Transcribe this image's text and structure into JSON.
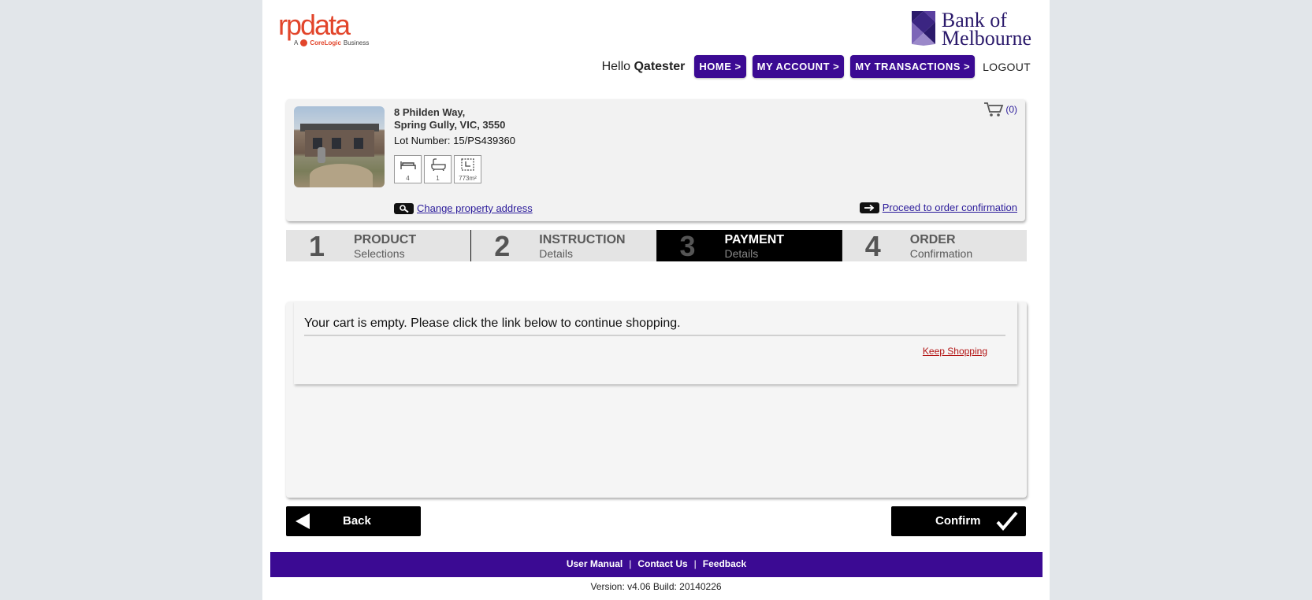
{
  "header": {
    "logo_left": {
      "word": "rpdata",
      "sub_prefix": "A",
      "sub_brand": "CoreLogic",
      "sub_suffix": "Business"
    },
    "logo_right": {
      "line1": "Bank of",
      "line2": "Melbourne"
    },
    "greeting": "Hello",
    "username": "Qatester",
    "nav": [
      {
        "label": "HOME >"
      },
      {
        "label": "MY ACCOUNT >"
      },
      {
        "label": "MY TRANSACTIONS >"
      }
    ],
    "logout_label": "LOGOUT"
  },
  "property": {
    "address_line1": "8 Philden Way,",
    "address_line2": "Spring Gully, VIC, 3550",
    "lot": "Lot Number: 15/PS439360",
    "features": {
      "beds": "4",
      "baths": "1",
      "area": "773m²"
    },
    "cart_count": "(0)",
    "change_address_label": "Change property address",
    "proceed_label": "Proceed to order confirmation"
  },
  "steps": [
    {
      "num": "1",
      "title": "PRODUCT",
      "subtitle": "Selections",
      "active": false
    },
    {
      "num": "2",
      "title": "INSTRUCTION",
      "subtitle": "Details",
      "active": false
    },
    {
      "num": "3",
      "title": "PAYMENT",
      "subtitle": "Details",
      "active": true
    },
    {
      "num": "4",
      "title": "ORDER",
      "subtitle": "Confirmation",
      "active": false
    }
  ],
  "cart": {
    "message": "Your cart is empty. Please click the link below to continue shopping.",
    "keep_shopping": "Keep Shopping"
  },
  "buttons": {
    "back": "Back",
    "confirm": "Confirm"
  },
  "footer": {
    "links": [
      "User Manual",
      "Contact Us",
      "Feedback"
    ],
    "separator": "|",
    "version": "Version: v4.06 Build: 20140226"
  },
  "colors": {
    "brand_purple": "#3b0a93",
    "rp_red": "#e2452b",
    "link_blue": "#2a1a9a",
    "keep_red": "#b31414"
  }
}
